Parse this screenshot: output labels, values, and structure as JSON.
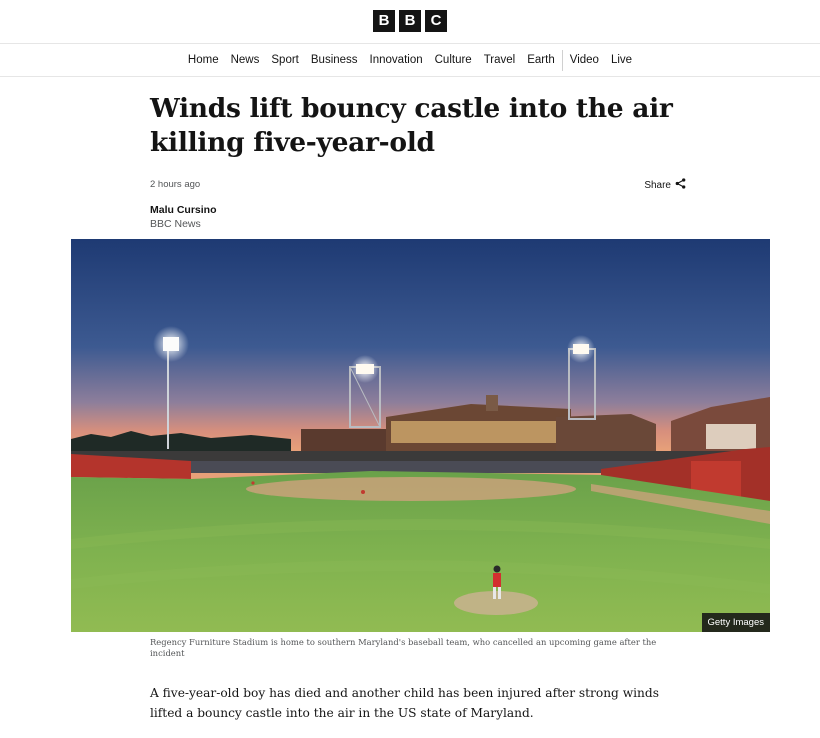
{
  "brand": {
    "letters": [
      "B",
      "B",
      "C"
    ]
  },
  "nav": {
    "items": [
      "Home",
      "News",
      "Sport",
      "Business",
      "Innovation",
      "Culture",
      "Travel",
      "Earth"
    ],
    "items_right": [
      "Video",
      "Live"
    ]
  },
  "article": {
    "headline": "Winds lift bouncy castle into the air killing five-year-old",
    "timestamp": "2 hours ago",
    "share_label": "Share",
    "author": "Malu Cursino",
    "publisher": "BBC News",
    "image_credit": "Getty Images",
    "image_caption": "Regency Furniture Stadium is home to southern Maryland's baseball team, who cancelled an upcoming game after the incident",
    "lede": "A five-year-old boy has died and another child has been injured after strong winds lifted a bouncy castle into the air in the US state of Maryland."
  },
  "colors": {
    "text": "#141414",
    "muted": "#545658",
    "rule": "#e6e6e6"
  }
}
